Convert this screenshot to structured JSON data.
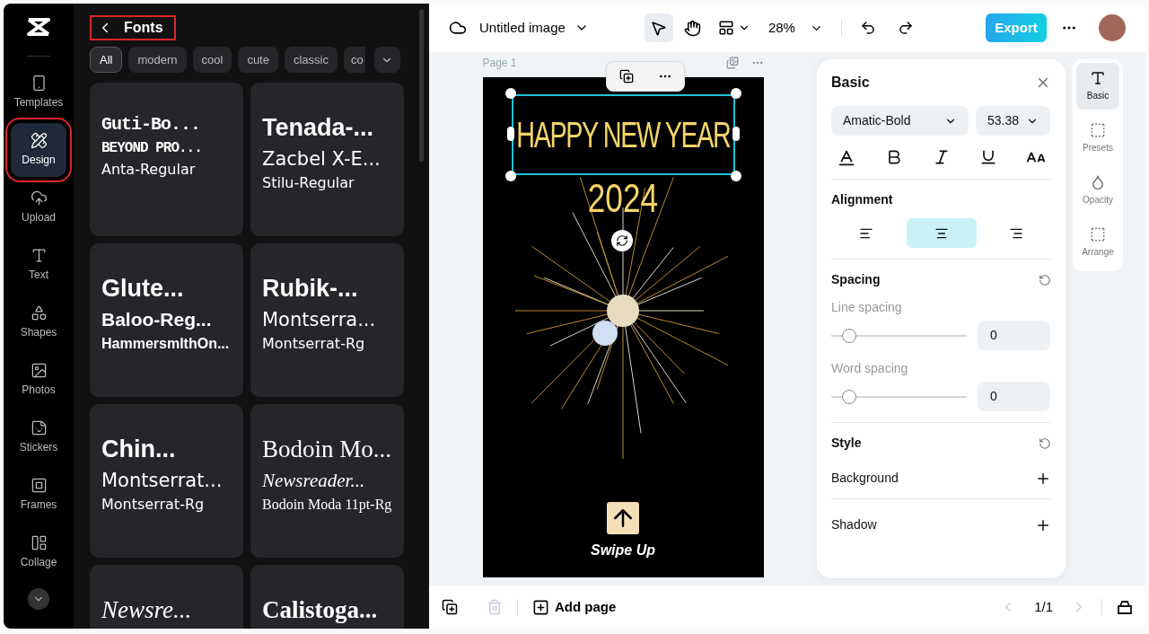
{
  "rail": {
    "items": [
      {
        "label": "Templates",
        "selected": false
      },
      {
        "label": "Design",
        "selected": true
      },
      {
        "label": "Upload",
        "selected": false
      },
      {
        "label": "Text",
        "selected": false
      },
      {
        "label": "Shapes",
        "selected": false
      },
      {
        "label": "Photos",
        "selected": false
      },
      {
        "label": "Stickers",
        "selected": false
      },
      {
        "label": "Frames",
        "selected": false
      },
      {
        "label": "Collage",
        "selected": false
      }
    ]
  },
  "fonts_panel": {
    "title": "Fonts",
    "filters": [
      {
        "label": "All",
        "selected": true
      },
      {
        "label": "modern",
        "selected": false
      },
      {
        "label": "cool",
        "selected": false
      },
      {
        "label": "cute",
        "selected": false
      },
      {
        "label": "classic",
        "selected": false
      },
      {
        "label": "co",
        "selected": false
      }
    ],
    "cards": [
      {
        "lines": [
          {
            "text": "Guti-Bo...",
            "kind": "techno"
          },
          {
            "text": "BEYOND PRO...",
            "kind": "techno"
          },
          {
            "text": "Anta-Regular",
            "kind": "regular"
          }
        ]
      },
      {
        "lines": [
          {
            "text": "Tenada-...",
            "kind": "display"
          },
          {
            "text": "Zacbel X-E...",
            "kind": "regular"
          },
          {
            "text": "Stilu-Regular",
            "kind": "regular"
          }
        ]
      },
      {
        "lines": [
          {
            "text": "Glute...",
            "kind": "display"
          },
          {
            "text": "Baloo-Reg...",
            "kind": "display"
          },
          {
            "text": "HammersmlthOn...",
            "kind": "display"
          }
        ]
      },
      {
        "lines": [
          {
            "text": "Rubik-...",
            "kind": "display"
          },
          {
            "text": "Montserra...",
            "kind": "regular"
          },
          {
            "text": "Montserrat-Rg",
            "kind": "regular"
          }
        ]
      },
      {
        "lines": [
          {
            "text": "Chin...",
            "kind": "display"
          },
          {
            "text": "Montserrat...",
            "kind": "regular"
          },
          {
            "text": "Montserrat-Rg",
            "kind": "regular"
          }
        ]
      },
      {
        "lines": [
          {
            "text": "Bodoin Mo...",
            "kind": "serif"
          },
          {
            "text": "Newsreader...",
            "kind": "serif-italic"
          },
          {
            "text": "Bodoin Moda 11pt-Rg",
            "kind": "serif"
          }
        ]
      },
      {
        "lines": [
          {
            "text": "Newsre...",
            "kind": "serif-italic"
          }
        ]
      },
      {
        "lines": [
          {
            "text": "Calistoga...",
            "kind": "serif-bold"
          }
        ]
      }
    ]
  },
  "toolbar": {
    "title": "Untitled image",
    "zoom": "28%",
    "export": "Export",
    "tools": [
      {
        "kind": "select",
        "selected": true
      },
      {
        "kind": "hand",
        "selected": false
      }
    ]
  },
  "canvas": {
    "page_label": "Page 1",
    "headline": "HAPPY NEW YEAR",
    "year": "2024",
    "cta": "Swipe Up"
  },
  "properties": {
    "title": "Basic",
    "font": "Amatic-Bold",
    "size": "53.38",
    "alignment_title": "Alignment",
    "alignments": [
      {
        "kind": "left",
        "selected": false
      },
      {
        "kind": "center",
        "selected": true
      },
      {
        "kind": "right",
        "selected": false
      }
    ],
    "spacing_title": "Spacing",
    "sliders": [
      {
        "label": "Line spacing",
        "level": 0.09,
        "value": "0"
      },
      {
        "label": "Word spacing",
        "level": 0.09,
        "value": "0"
      }
    ],
    "style_title": "Style",
    "options": [
      "Background",
      "Shadow"
    ]
  },
  "side_tabs": [
    {
      "label": "Basic",
      "selected": true
    },
    {
      "label": "Presets",
      "selected": false
    },
    {
      "label": "Opacity",
      "selected": false
    },
    {
      "label": "Arrange",
      "selected": false
    }
  ],
  "bottom_bar": {
    "add_page": "Add page",
    "pager": "1/1"
  }
}
